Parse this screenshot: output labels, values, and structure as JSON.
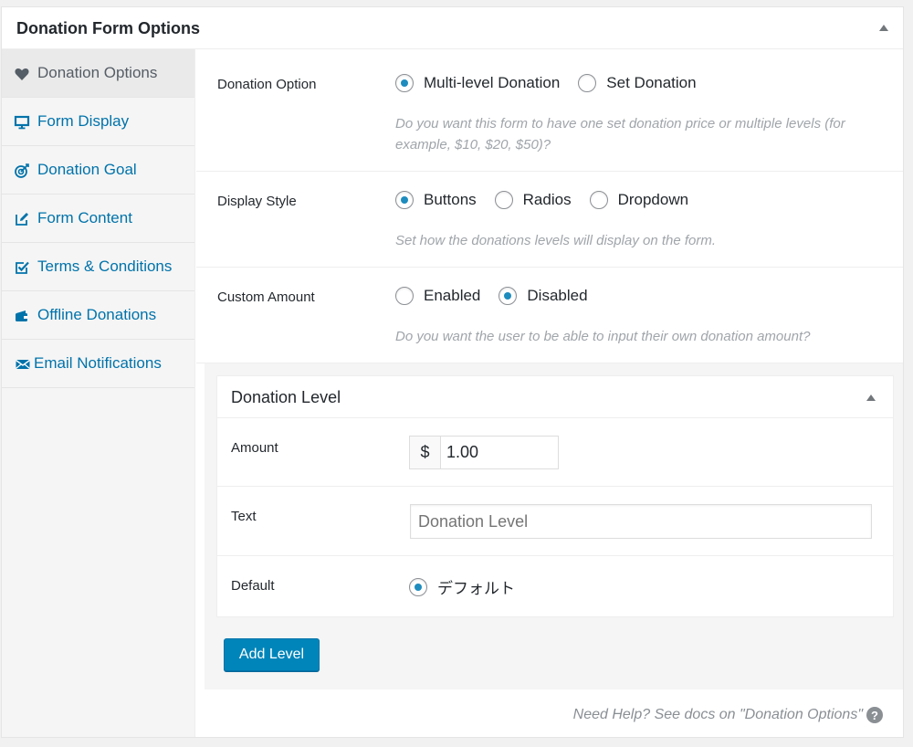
{
  "panel": {
    "title": "Donation Form Options"
  },
  "sidebar": {
    "items": [
      {
        "label": "Donation Options",
        "icon": "heart-icon",
        "active": true
      },
      {
        "label": "Form Display",
        "icon": "monitor-icon"
      },
      {
        "label": "Donation Goal",
        "icon": "target-icon"
      },
      {
        "label": "Form Content",
        "icon": "edit-icon"
      },
      {
        "label": "Terms & Conditions",
        "icon": "checkbox-icon"
      },
      {
        "label": "Offline Donations",
        "icon": "wallet-icon"
      },
      {
        "label": "Email Notifications",
        "icon": "envelope-icon"
      }
    ]
  },
  "donation_option": {
    "label": "Donation Option",
    "options": [
      "Multi-level Donation",
      "Set Donation"
    ],
    "selected": "Multi-level Donation",
    "hint": "Do you want this form to have one set donation price or multiple levels (for example, $10, $20, $50)?"
  },
  "display_style": {
    "label": "Display Style",
    "options": [
      "Buttons",
      "Radios",
      "Dropdown"
    ],
    "selected": "Buttons",
    "hint": "Set how the donations levels will display on the form."
  },
  "custom_amount": {
    "label": "Custom Amount",
    "options": [
      "Enabled",
      "Disabled"
    ],
    "selected": "Disabled",
    "hint": "Do you want the user to be able to input their own donation amount?"
  },
  "donation_level": {
    "title": "Donation Level",
    "amount_label": "Amount",
    "currency": "$",
    "amount_value": "1.00",
    "text_label": "Text",
    "text_placeholder": "Donation Level",
    "default_label": "Default",
    "default_option": "デフォルト"
  },
  "add_level_label": "Add Level",
  "help": {
    "text": "Need Help? See docs on \"Donation Options\"",
    "icon_glyph": "?"
  },
  "colors": {
    "accent": "#0073aa",
    "button": "#0085ba",
    "radio_dot": "#1e8cbe"
  }
}
